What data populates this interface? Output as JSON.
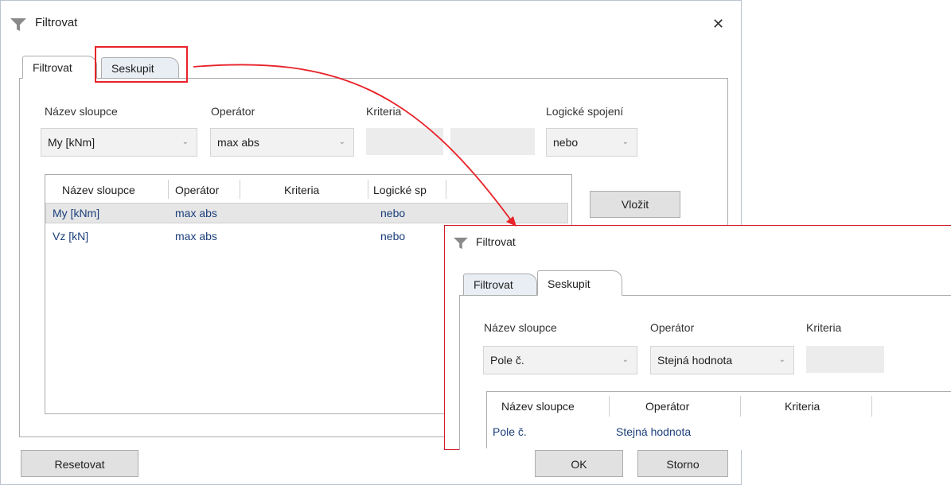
{
  "window": {
    "title": "Filtrovat",
    "close_glyph": "✕",
    "icon": "filter-icon"
  },
  "tabs": [
    {
      "label": "Filtrovat"
    },
    {
      "label": "Seskupit"
    }
  ],
  "form": {
    "col_label": "Název sloupce",
    "op_label": "Operátor",
    "criteria_label": "Kriteria",
    "logic_label": "Logické spojení",
    "col_value": "My [kNm]",
    "op_value": "max abs",
    "logic_value": "nebo"
  },
  "grid": {
    "headers": [
      "Název sloupce",
      "Operátor",
      "Kriteria",
      "Logické sp"
    ],
    "rows": [
      {
        "col": "My [kNm]",
        "op": "max abs",
        "logic": "nebo"
      },
      {
        "col": "Vz [kN]",
        "op": "max abs",
        "logic": "nebo"
      }
    ]
  },
  "buttons": {
    "insert": "Vložit",
    "reset": "Resetovat",
    "ok": "OK",
    "cancel": "Storno"
  },
  "inset": {
    "title": "Filtrovat",
    "tabs": [
      "Filtrovat",
      "Seskupit"
    ],
    "col_label": "Název sloupce",
    "op_label": "Operátor",
    "criteria_label": "Kriteria",
    "col_value": "Pole č.",
    "op_value": "Stejná hodnota",
    "grid_headers": [
      "Název sloupce",
      "Operátor",
      "Kriteria"
    ],
    "row": {
      "col": "Pole č.",
      "op": "Stejná hodnota"
    }
  },
  "colors": {
    "highlight": "#e8232a",
    "cell_text": "#1b3e7a"
  }
}
